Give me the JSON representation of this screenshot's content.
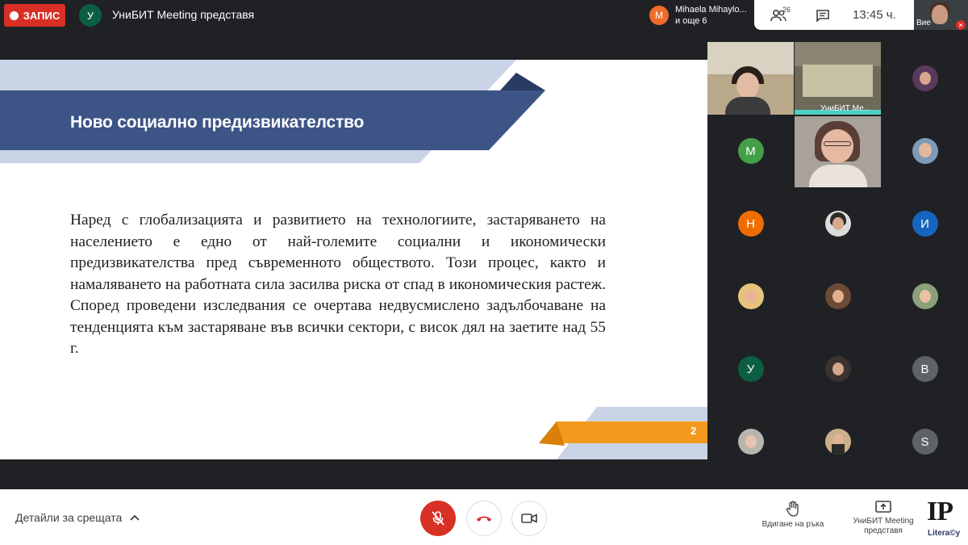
{
  "top_bar": {
    "recording_label": "ЗАПИС",
    "presenter_avatar_letter": "У",
    "presenter_title": "УниБИТ Meeting представя",
    "speaker": {
      "avatar_letter": "M",
      "line1": "Mihaela Mihaylo...",
      "line2": "и още 6",
      "color": "#ef6c2b"
    },
    "people_count": "26",
    "clock": "13:45 ч.",
    "self_label": "Вие"
  },
  "slide": {
    "title": "Ново социално предизвикателство",
    "body": "Наред с глобализацията и развитието на технологиите, застаряването на населението е едно от най-големите социални и икономически предизвикателства пред съвременното обществото. Този процес, както и намаляването на работната сила засилва риска от спад в икономическия растеж. Според проведени изследвания се очертава недвусмислено задълбочаване на тенденцията към застаряване във всички сектори, с висок дял на заетите над 55 г.",
    "page_number": "2",
    "colors": {
      "banner_dark": "#3d5486",
      "banner_light": "#c9d3e6",
      "accent_orange": "#f39a1d"
    }
  },
  "participants": {
    "camera_room_label": "УниБИТ Ме...",
    "letters": {
      "m": "М",
      "n": "Н",
      "i": "И",
      "u": "У",
      "v": "В",
      "s": "S"
    },
    "colors": {
      "m": "#43a047",
      "n": "#ef6c00",
      "i": "#1565c0",
      "u": "#0b5e42",
      "v": "#5f6368",
      "s": "#5f6368"
    }
  },
  "bottom_bar": {
    "details_label": "Детайли за срещата",
    "raise_hand_label": "Вдигане на ръка",
    "presenting_label_1": "УниБИТ Meeting",
    "presenting_label_2": "представя",
    "logo_text": "IP",
    "logo_sub": "Litera©y"
  }
}
